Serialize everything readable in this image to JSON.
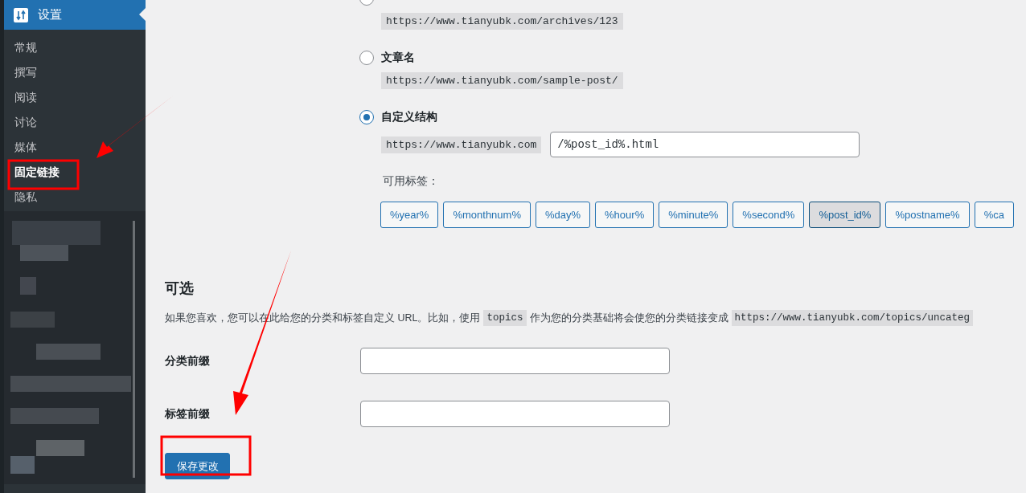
{
  "sidebar": {
    "header": {
      "label": "设置"
    },
    "items": [
      {
        "label": "常规",
        "selected": false
      },
      {
        "label": "撰写",
        "selected": false
      },
      {
        "label": "阅读",
        "selected": false
      },
      {
        "label": "讨论",
        "selected": false
      },
      {
        "label": "媒体",
        "selected": false
      },
      {
        "label": "固定链接",
        "selected": true
      },
      {
        "label": "隐私",
        "selected": false
      }
    ]
  },
  "permalink_options": [
    {
      "selected": false,
      "example": "https://www.tianyubk.com/archives/123"
    },
    {
      "label": "文章名",
      "selected": false,
      "example": "https://www.tianyubk.com/sample-post/"
    },
    {
      "label": "自定义结构",
      "selected": true,
      "example": "https://www.tianyubk.com",
      "value": "/%post_id%.html"
    }
  ],
  "available_tags": {
    "label": "可用标签：",
    "tags": [
      {
        "label": "%year%",
        "selected": false
      },
      {
        "label": "%monthnum%",
        "selected": false
      },
      {
        "label": "%day%",
        "selected": false
      },
      {
        "label": "%hour%",
        "selected": false
      },
      {
        "label": "%minute%",
        "selected": false
      },
      {
        "label": "%second%",
        "selected": false
      },
      {
        "label": "%post_id%",
        "selected": true
      },
      {
        "label": "%postname%",
        "selected": false
      },
      {
        "label": "%ca",
        "selected": false
      }
    ]
  },
  "optional": {
    "title": "可选",
    "description": "如果您喜欢，您可以在此给您的分类和标签自定义 URL。比如，使用",
    "code": "topics",
    "description_2": "作为您的分类基础将会使您的分类链接变成",
    "code_2": "https://www.tianyubk.com/topics/uncateg",
    "fields": [
      {
        "label": "分类前缀"
      },
      {
        "label": "标签前缀"
      }
    ]
  },
  "save_button": "保存更改"
}
